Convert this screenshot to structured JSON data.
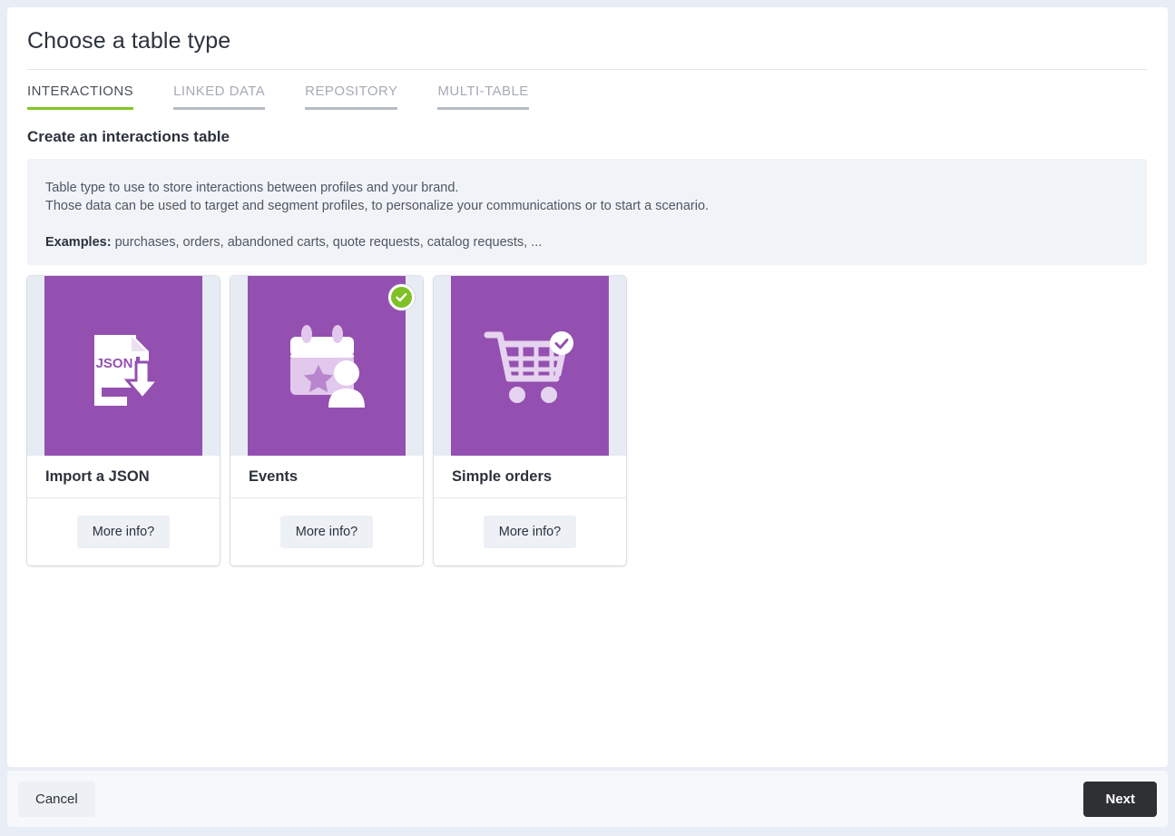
{
  "page": {
    "title": "Choose a table type"
  },
  "tabs": [
    {
      "label": "INTERACTIONS",
      "active": true
    },
    {
      "label": "LINKED DATA",
      "active": false
    },
    {
      "label": "REPOSITORY",
      "active": false
    },
    {
      "label": "MULTI-TABLE",
      "active": false
    }
  ],
  "section": {
    "heading": "Create an interactions table"
  },
  "info": {
    "line1": "Table type to use to store interactions between profiles and your brand.",
    "line2": "Those data can be used to target and segment profiles, to personalize your communications or to start a scenario.",
    "examples_label": "Examples:",
    "examples_value": " purchases, orders, abandoned carts, quote requests, catalog requests, ..."
  },
  "cards": [
    {
      "title": "Import a JSON",
      "icon": "json-file-download-icon",
      "icon_text": "JSON",
      "more_info_label": "More info?",
      "selected": false
    },
    {
      "title": "Events",
      "icon": "calendar-star-person-icon",
      "more_info_label": "More info?",
      "selected": true
    },
    {
      "title": "Simple orders",
      "icon": "shopping-cart-check-icon",
      "more_info_label": "More info?",
      "selected": false
    }
  ],
  "footer": {
    "cancel_label": "Cancel",
    "next_label": "Next"
  },
  "colors": {
    "tile_purple": "#9450b0",
    "accent_green": "#84c524",
    "badge_green": "#7fc125",
    "page_background": "#e9edf5",
    "panel_background": "#ffffff",
    "info_background": "#f0f3f8",
    "next_button": "#2f3033"
  }
}
